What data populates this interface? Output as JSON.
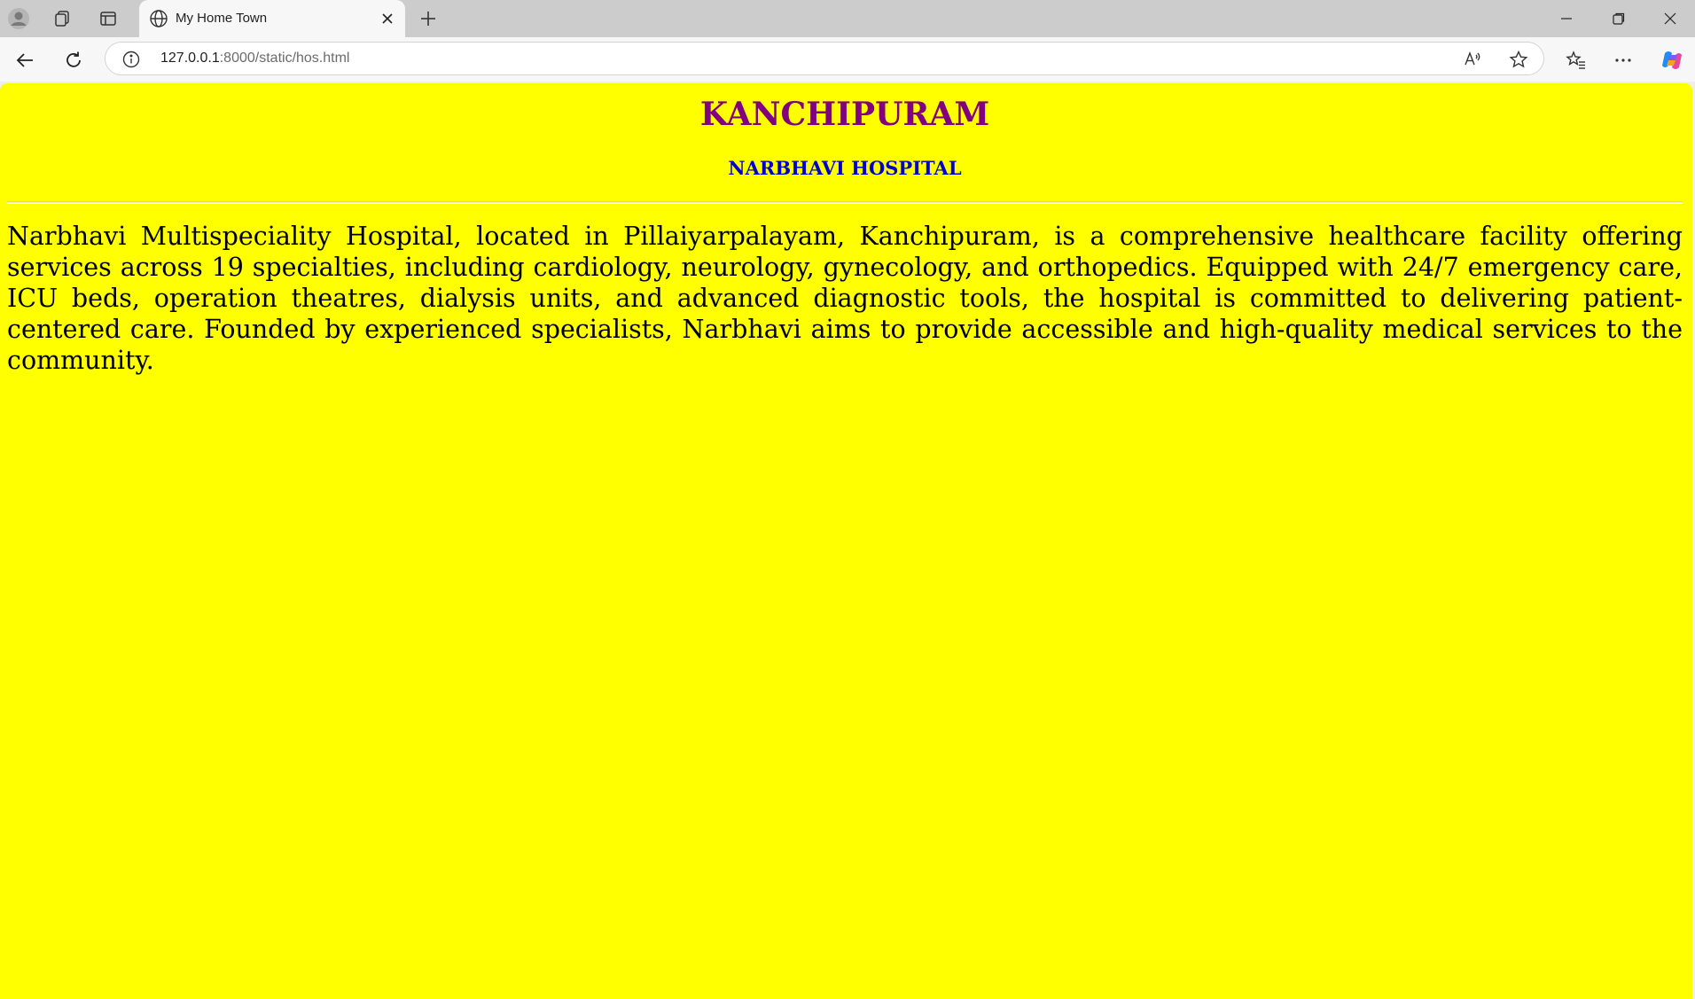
{
  "browser": {
    "tab": {
      "title": "My Home Town"
    },
    "address": {
      "host": "127.0.0.1",
      "path": ":8000/static/hos.html"
    },
    "icons": {
      "profile": "profile-icon",
      "workspaces": "workspaces-icon",
      "tab_actions": "tab-actions-icon",
      "favicon": "globe-icon",
      "close_tab": "close-icon",
      "new_tab": "plus-icon",
      "minimize": "minimize-icon",
      "restore": "restore-icon",
      "close_window": "close-icon",
      "back": "back-arrow-icon",
      "refresh": "refresh-icon",
      "site_info": "info-icon",
      "read_aloud": "read-aloud-icon",
      "favorite": "star-icon",
      "favorites": "favorites-icon",
      "more": "more-icon",
      "copilot": "copilot-icon"
    }
  },
  "page": {
    "background": "#ffff00",
    "heading": "KANCHIPURAM",
    "heading_color": "#800080",
    "subheading": "NARBHAVI HOSPITAL",
    "subheading_color": "#0000cd",
    "paragraph": "Narbhavi Multispeciality Hospital, located in Pillaiyarpalayam, Kanchipuram, is a comprehensive healthcare facility offering services across 19 specialties, including cardiology, neurology, gynecology, and orthopedics. Equipped with 24/7 emergency care, ICU beds, operation theatres, dialysis units, and advanced diagnostic tools, the hospital is committed to delivering patient-centered care. Founded by experienced specialists, Narbhavi aims to provide accessible and high-quality medical services to the community."
  }
}
